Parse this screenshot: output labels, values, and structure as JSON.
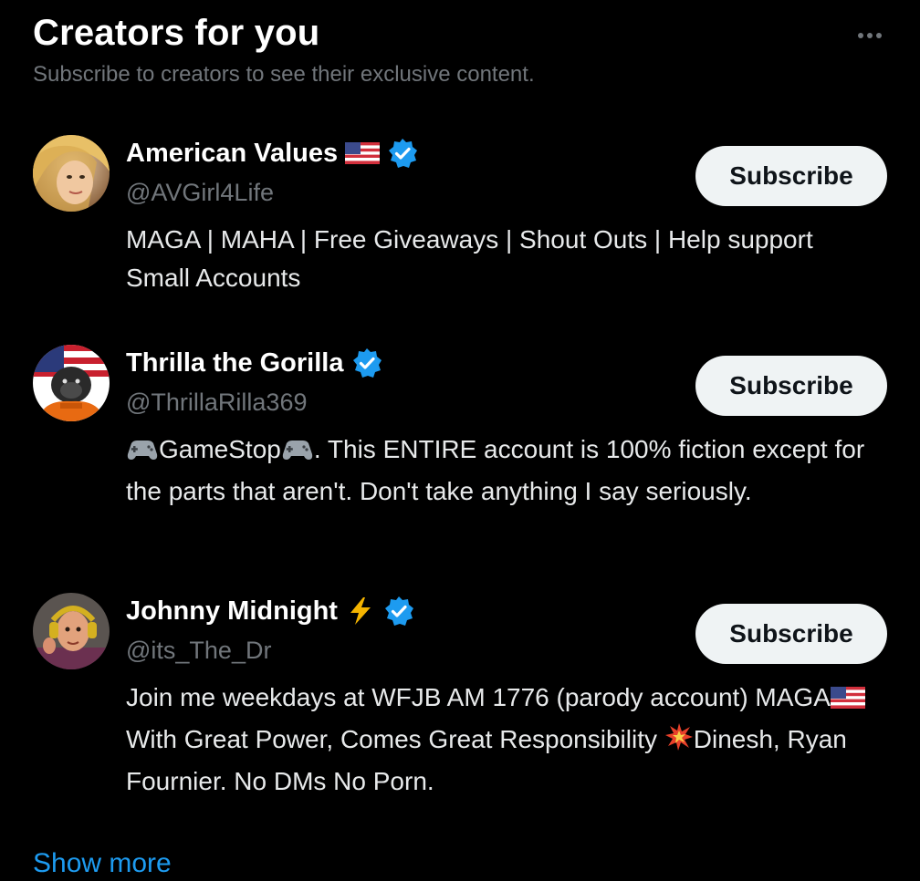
{
  "header": {
    "title": "Creators for you",
    "subtitle": "Subscribe to creators to see their exclusive content."
  },
  "more_icon": "more-horizontal-icon",
  "accent_color": "#1d9bf0",
  "creators": [
    {
      "name": "American Values",
      "name_emoji": "us-flag-icon",
      "verified": true,
      "handle": "@AVGirl4Life",
      "bio": "MAGA | MAHA | Free Giveaways | Shout Outs | Help support Small Accounts",
      "button_label": "Subscribe"
    },
    {
      "name": "Thrilla the Gorilla",
      "verified": true,
      "handle": "@ThrillaRilla369",
      "bio_parts": [
        "GameStop",
        ". This ENTIRE account is 100% fiction except for the parts that aren't. Don't take anything I say seriously."
      ],
      "bio_emoji": "game-controller-icon",
      "button_label": "Subscribe"
    },
    {
      "name": "Johnny Midnight",
      "name_emoji": "lightning-icon",
      "verified": true,
      "handle": "@its_The_Dr",
      "bio_parts": [
        "Join me weekdays at WFJB AM 1776 (parody account) MAGA",
        " With Great Power, Comes Great Responsibility ",
        "Dinesh, Ryan Fournier. No DMs No Porn."
      ],
      "bio_emojis": [
        "us-flag-icon",
        "collision-icon"
      ],
      "button_label": "Subscribe"
    }
  ],
  "show_more_label": "Show more"
}
